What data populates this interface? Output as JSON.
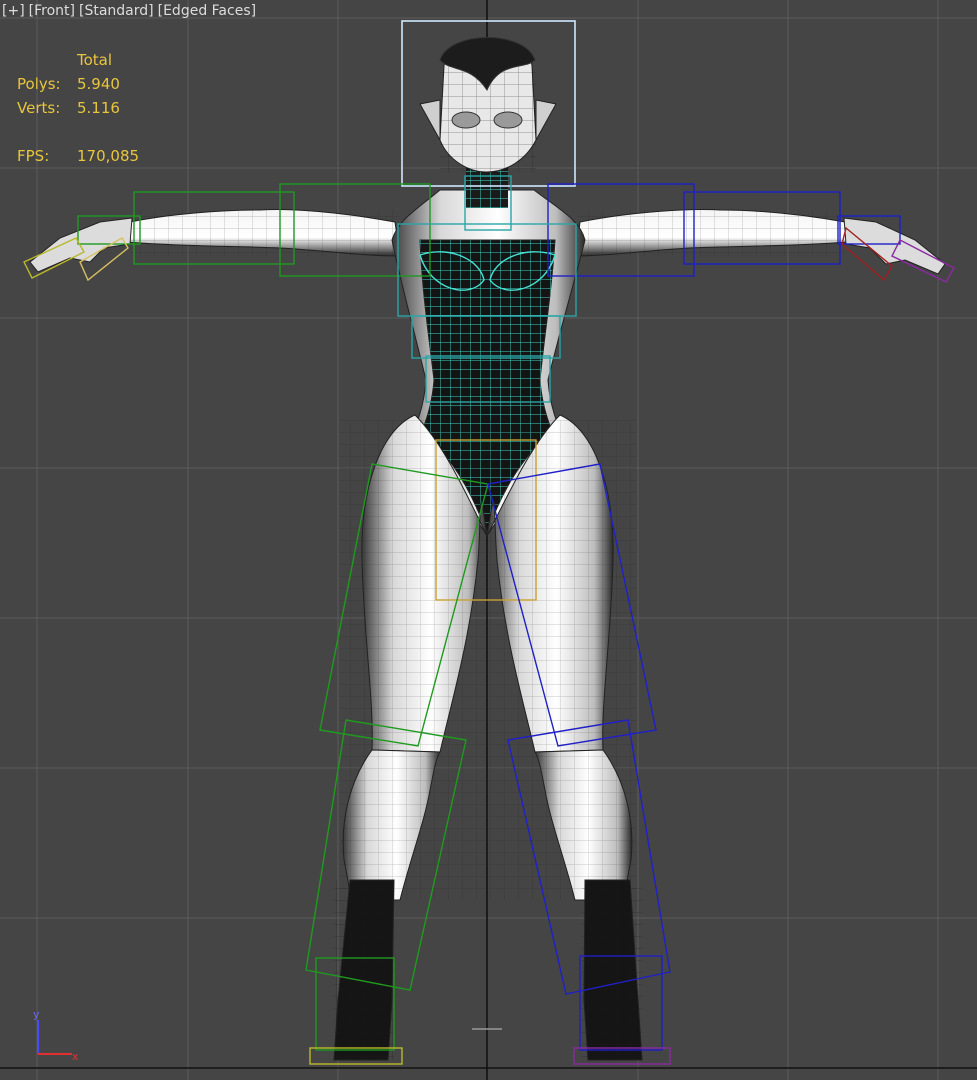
{
  "viewport": {
    "labels": [
      "[+]",
      "[Front]",
      "[Standard]",
      "[Edged Faces]"
    ]
  },
  "stats": {
    "header": "Total",
    "polys_label": "Polys:",
    "polys_value": "5.940",
    "verts_label": "Verts:",
    "verts_value": "5.116",
    "fps_label": "FPS:",
    "fps_value": "170,085"
  },
  "colors": {
    "background": "#454545",
    "grid": "#5e5e5e",
    "grid_center": "#111111",
    "stats_text": "#e8c63c",
    "label_text": "#dcdcdc",
    "bone_left": "#1f9a1f",
    "bone_right": "#2020c8",
    "bone_spine": "#2aa6a6",
    "bone_pelvis": "#c8a032",
    "selection": "#cfe8ff",
    "hand_left": "#b8b82a",
    "hand_right": "#a02020",
    "finger_right": "#8a2aa0"
  },
  "gizmo": {
    "axis_y": "y",
    "axis_x": "x"
  }
}
